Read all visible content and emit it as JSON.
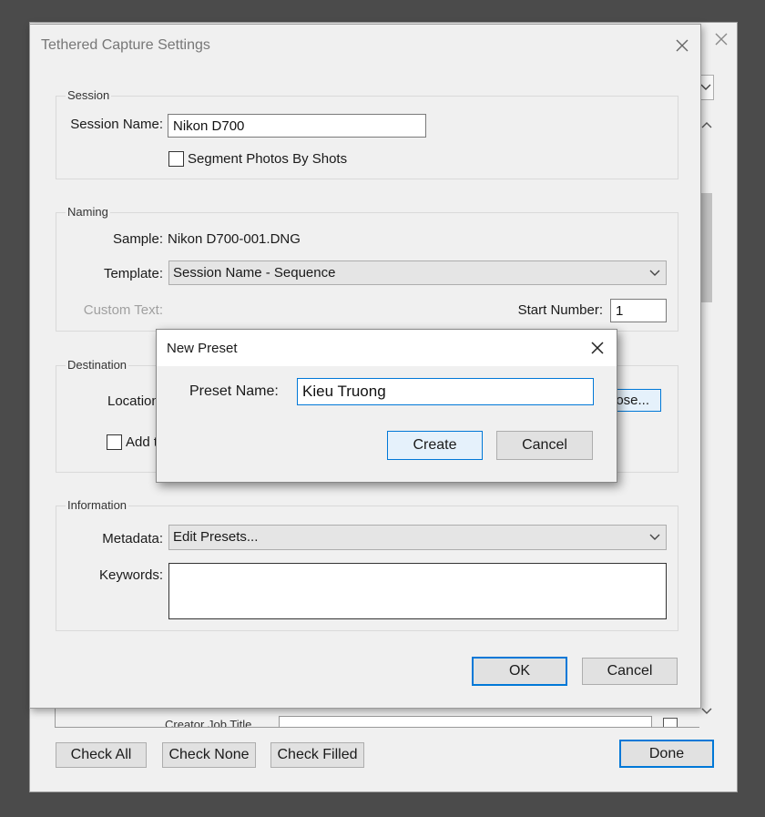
{
  "background_window": {
    "scroll_row_label": "Creator Job Title",
    "buttons": {
      "check_all": "Check All",
      "check_none": "Check None",
      "check_filled": "Check Filled",
      "done": "Done"
    }
  },
  "tethered_dialog": {
    "title": "Tethered Capture Settings",
    "session": {
      "legend": "Session",
      "name_label": "Session Name:",
      "name_value": "Nikon D700",
      "segment_label": "Segment Photos By Shots"
    },
    "naming": {
      "legend": "Naming",
      "sample_label": "Sample:",
      "sample_value": "Nikon D700-001.DNG",
      "template_label": "Template:",
      "template_value": "Session Name - Sequence",
      "custom_text_label": "Custom Text:",
      "start_number_label": "Start Number:",
      "start_number_value": "1"
    },
    "destination": {
      "legend": "Destination",
      "location_label": "Location",
      "choose_label": "ose...",
      "add_label": "Add t"
    },
    "information": {
      "legend": "Information",
      "metadata_label": "Metadata:",
      "metadata_value": "Edit Presets...",
      "keywords_label": "Keywords:",
      "keywords_value": ""
    },
    "buttons": {
      "ok": "OK",
      "cancel": "Cancel"
    }
  },
  "new_preset_dialog": {
    "title": "New Preset",
    "preset_name_label": "Preset Name:",
    "preset_name_value": "Kieu Truong",
    "buttons": {
      "create": "Create",
      "cancel": "Cancel"
    }
  },
  "colors": {
    "desktop": "#4b4b4b",
    "dialog_bg": "#f0f0f0",
    "accent": "#0078d7",
    "button_bg": "#e1e1e1"
  }
}
